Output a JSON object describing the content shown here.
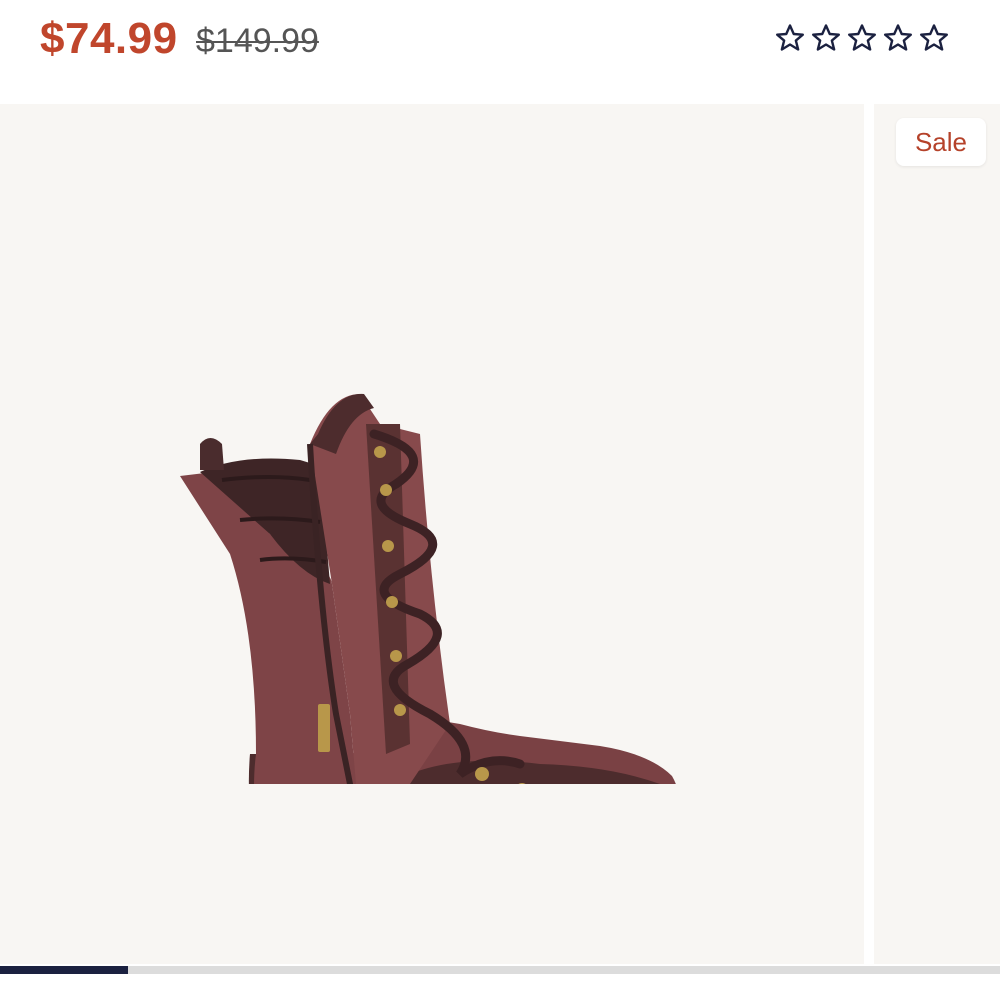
{
  "price": {
    "sale": "$74.99",
    "original": "$149.99",
    "sale_color": "#c0462c",
    "original_color": "#555555"
  },
  "rating": {
    "stars_filled": 0,
    "stars_total": 5,
    "star_icon": "star-outline-icon",
    "star_color": "#1b2140"
  },
  "gallery": {
    "badge": "Sale",
    "badge_color": "#b5422a",
    "slide_background": "#f8f6f3",
    "current_slide": 1,
    "progress_fraction": 0.128,
    "progress_color": "#1b2140",
    "track_color": "#dcdcdc"
  }
}
